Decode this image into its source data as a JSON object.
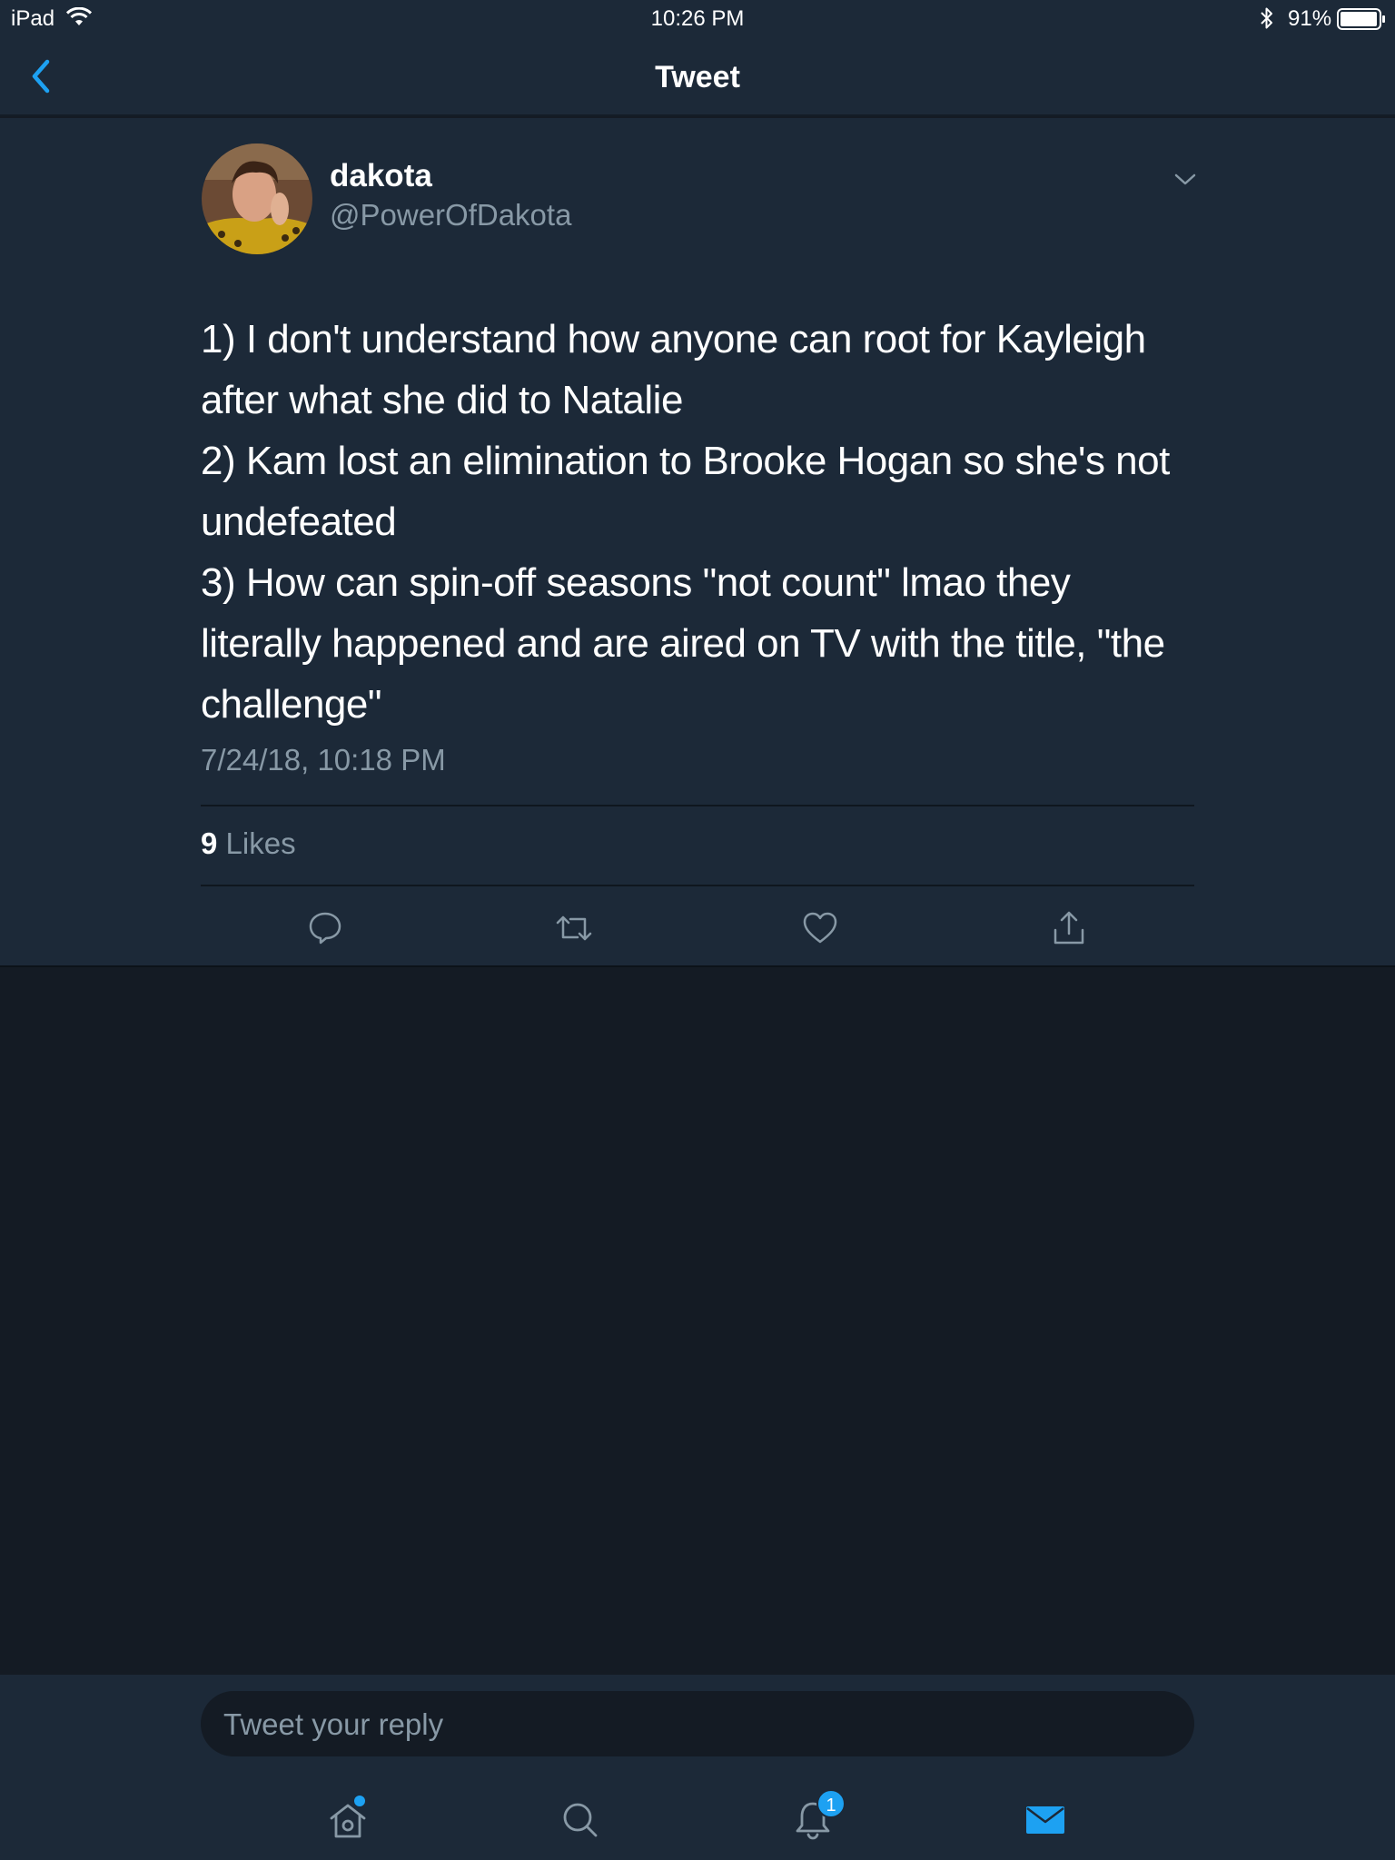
{
  "status_bar": {
    "device": "iPad",
    "time": "10:26 PM",
    "battery": "91%"
  },
  "nav": {
    "title": "Tweet"
  },
  "tweet": {
    "author": {
      "name": "dakota",
      "handle": "@PowerOfDakota"
    },
    "lines": [
      "1) I don't understand how anyone can root for Kayleigh",
      "after what she did to Natalie",
      "2) Kam lost an elimination to Brooke Hogan so she's not",
      "undefeated",
      "3) How can spin-off seasons \"not count\" lmao they",
      "literally happened and are aired on TV with the title, \"the",
      "challenge\""
    ],
    "timestamp": "7/24/18, 10:18 PM",
    "likes_count": "9",
    "likes_label": "Likes"
  },
  "actions": [
    "reply-icon",
    "retweet-icon",
    "like-icon",
    "share-icon"
  ],
  "reply": {
    "placeholder": "Tweet your reply"
  },
  "tabbar": {
    "notifications_badge": "1"
  },
  "colors": {
    "panel": "#1c2938",
    "background": "#141b24",
    "secondary_text": "#8899a6",
    "accent": "#1da1f2"
  }
}
